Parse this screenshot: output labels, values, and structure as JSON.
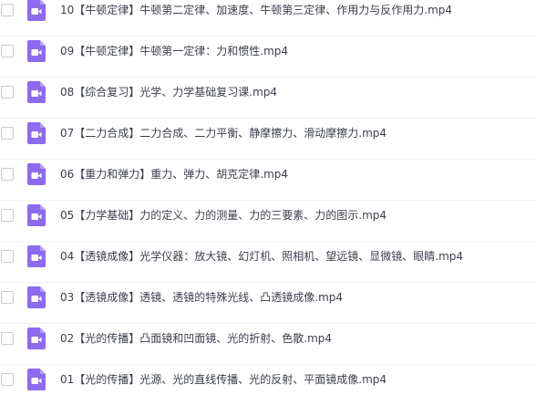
{
  "file_list": {
    "icon": "video-file-icon",
    "icon_color": "#8d6bf0",
    "items": [
      {
        "name": "10【牛顿定律】牛顿第二定律、加速度、牛顿第三定律、作用力与反作用力.mp4"
      },
      {
        "name": "09【牛顿定律】牛顿第一定律：力和惯性.mp4"
      },
      {
        "name": "08【综合复习】光学、力学基础复习课.mp4"
      },
      {
        "name": "07【二力合成】二力合成、二力平衡、静摩擦力、滑动摩擦力.mp4"
      },
      {
        "name": "06【重力和弹力】重力、弹力、胡克定律.mp4"
      },
      {
        "name": "05【力学基础】力的定义、力的测量、力的三要素、力的图示.mp4"
      },
      {
        "name": "04【透镜成像】光学仪器：放大镜、幻灯机、照相机、望远镜、显微镜、眼睛.mp4"
      },
      {
        "name": "03【透镜成像】透镜、透镜的特殊光线、凸透镜成像.mp4"
      },
      {
        "name": "02【光的传播】凸面镜和凹面镜、光的折射、色散.mp4"
      },
      {
        "name": "01【光的传播】光源、光的直线传播、光的反射、平面镜成像.mp4"
      }
    ]
  }
}
